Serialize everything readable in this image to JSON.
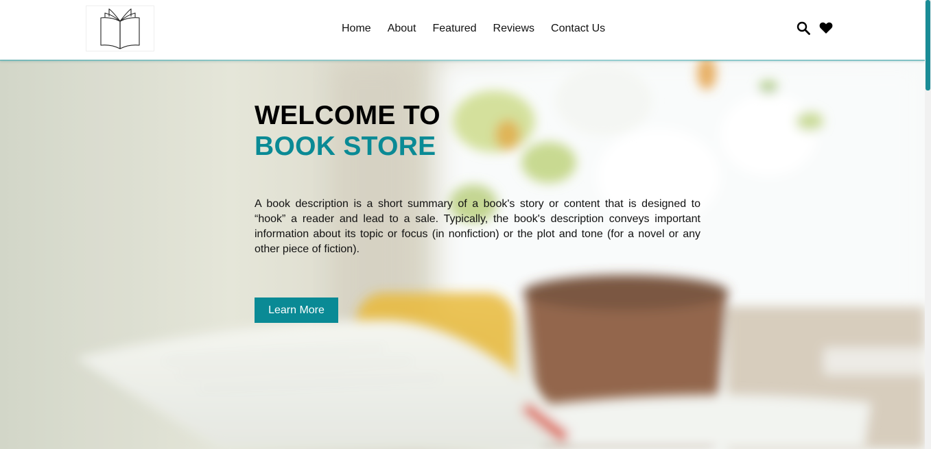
{
  "header": {
    "nav": [
      {
        "label": "Home"
      },
      {
        "label": "About"
      },
      {
        "label": "Featured"
      },
      {
        "label": "Reviews"
      },
      {
        "label": "Contact Us"
      }
    ],
    "icons": [
      "search-icon",
      "heart-icon"
    ]
  },
  "hero": {
    "title_line1": "WELCOME TO",
    "title_line2": "BOOK STORE",
    "description": "A book description is a short summary of a book's story or content that is designed to “hook” a reader and lead to a sale. Typically, the book's description conveys important information about its topic or focus (in nonfiction) or the plot and tone (for a novel or any other piece of fiction).",
    "button_label": "Learn More"
  },
  "colors": {
    "accent": "#0a8a95",
    "text": "#111111",
    "header_bg": "#ffffff"
  }
}
